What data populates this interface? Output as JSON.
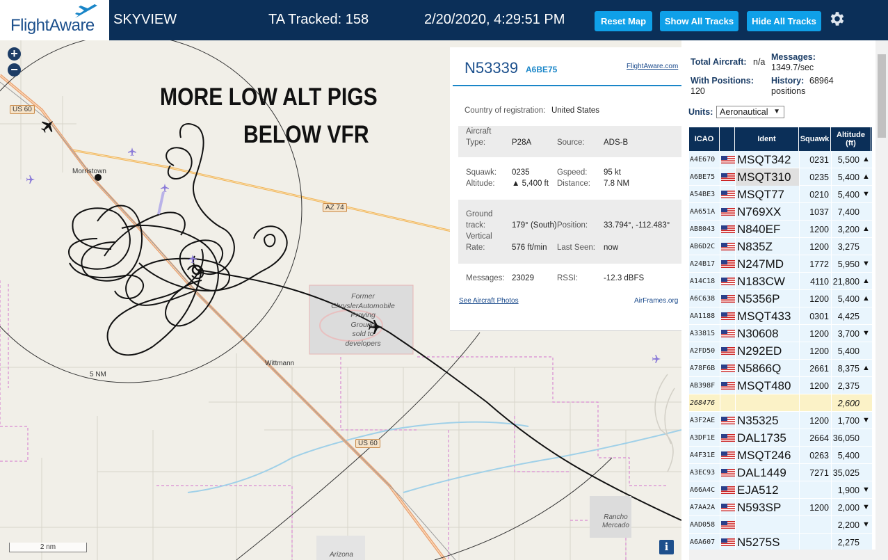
{
  "header": {
    "logo": "FlightAware",
    "app_title": "SKYVIEW",
    "tracked": "TA Tracked: 158",
    "datetime": "2/20/2020, 4:29:51 PM",
    "buttons": {
      "reset": "Reset Map",
      "show_all": "Show All Tracks",
      "hide_all": "Hide All Tracks"
    },
    "settings_icon": "gear-icon"
  },
  "map": {
    "zoom_in": "+",
    "zoom_out": "−",
    "annotation_line1": "MORE LOW ALT PIGS",
    "annotation_line2": "BELOW VFR",
    "labels": {
      "morristown": "Morristown",
      "wittmann": "Wittmann",
      "range_ring": "5 NM",
      "proving_ground": [
        "Former",
        "ChryslerAutomobile",
        "Proving",
        "Ground",
        "sold to",
        "developers"
      ],
      "rancho": [
        "Rancho",
        "Mercado"
      ],
      "arizona": "Arizona"
    },
    "road_shields": {
      "us60_north": "US 60",
      "az74": "AZ 74",
      "us60_south": "US 60"
    },
    "scale": "2 nm",
    "info": "i",
    "colors": {
      "track": "#111111",
      "az74": "#f0b45a",
      "us60": "#e8a070",
      "water": "#9fd0e8",
      "boundary": "#d98ad2",
      "aircraft": "#8a7ad8"
    }
  },
  "popup": {
    "registration": "N53339",
    "hex": "A6BE75",
    "fa_link": "FlightAware.com",
    "country_label": "Country of registration:",
    "country": "United States",
    "aircraft_type_label_1": "Aircraft",
    "aircraft_type_label_2": "Type:",
    "aircraft_type": "P28A",
    "source_label": "Source:",
    "source": "ADS-B",
    "squawk_label": "Squawk:",
    "squawk": "0235",
    "gspeed_label": "Gspeed:",
    "gspeed": "95 kt",
    "altitude_label": "Altitude:",
    "altitude": "▲ 5,400 ft",
    "distance_label": "Distance:",
    "distance": "7.8 NM",
    "ground_label_1": "Ground",
    "ground_label_2": "track:",
    "ground_track": "179° (South)",
    "position_label": "Position:",
    "position": "33.794°, -112.483°",
    "vrate_label_1": "Vertical",
    "vrate_label_2": "Rate:",
    "vrate": "576 ft/min",
    "lastseen_label": "Last Seen:",
    "lastseen": "now",
    "messages_label": "Messages:",
    "messages": "23029",
    "rssi_label": "RSSI:",
    "rssi": "-12.3 dBFS",
    "photos_link": "See Aircraft Photos",
    "airframes_link": "AirFrames.org"
  },
  "stats": {
    "total_label": "Total Aircraft:",
    "total": "n/a",
    "messages_label": "Messages:",
    "messages": "1349.7/sec",
    "positions_label": "With Positions:",
    "positions": "120",
    "history_label": "History:",
    "history_value": "68964",
    "history_unit": "positions",
    "units_label": "Units:",
    "units_value": "Aeronautical"
  },
  "table": {
    "headers": {
      "icao": "ICAO",
      "ident": "Ident",
      "squawk": "Squawk",
      "altitude_1": "Altitude",
      "altitude_2": "(ft)"
    },
    "rows": [
      {
        "icao": "A4E670",
        "ident": "MSQT342",
        "squawk": "0231",
        "alt": "5,500",
        "trend": "▲",
        "flag": true
      },
      {
        "icao": "A6BE75",
        "ident": "MSQT310",
        "squawk": "0235",
        "alt": "5,400",
        "trend": "▲",
        "flag": true,
        "selected": true
      },
      {
        "icao": "A54BE3",
        "ident": "MSQT77",
        "squawk": "0210",
        "alt": "5,400",
        "trend": "▼",
        "flag": true
      },
      {
        "icao": "AA651A",
        "ident": "N769XX",
        "squawk": "1037",
        "alt": "7,400",
        "trend": "",
        "flag": true
      },
      {
        "icao": "AB8043",
        "ident": "N840EF",
        "squawk": "1200",
        "alt": "3,200",
        "trend": "▲",
        "flag": true
      },
      {
        "icao": "AB6D2C",
        "ident": "N835Z",
        "squawk": "1200",
        "alt": "3,275",
        "trend": "",
        "flag": true
      },
      {
        "icao": "A24B17",
        "ident": "N247MD",
        "squawk": "1772",
        "alt": "5,950",
        "trend": "▼",
        "flag": true
      },
      {
        "icao": "A14C18",
        "ident": "N183CW",
        "squawk": "4110",
        "alt": "21,800",
        "trend": "▲",
        "flag": true
      },
      {
        "icao": "A6C638",
        "ident": "N5356P",
        "squawk": "1200",
        "alt": "5,400",
        "trend": "▲",
        "flag": true
      },
      {
        "icao": "AA1188",
        "ident": "MSQT433",
        "squawk": "0301",
        "alt": "4,425",
        "trend": "",
        "flag": true
      },
      {
        "icao": "A33815",
        "ident": "N30608",
        "squawk": "1200",
        "alt": "3,700",
        "trend": "▼",
        "flag": true
      },
      {
        "icao": "A2FD50",
        "ident": "N292ED",
        "squawk": "1200",
        "alt": "5,400",
        "trend": "",
        "flag": true
      },
      {
        "icao": "A78F6B",
        "ident": "N5866Q",
        "squawk": "2661",
        "alt": "8,375",
        "trend": "▲",
        "flag": true
      },
      {
        "icao": "AB398F",
        "ident": "MSQT480",
        "squawk": "1200",
        "alt": "2,375",
        "trend": "",
        "flag": true
      },
      {
        "icao": "268476",
        "ident": "",
        "squawk": "",
        "alt": "2,600",
        "trend": "",
        "flag": false,
        "nopos": true
      },
      {
        "icao": "A3F2AE",
        "ident": "N35325",
        "squawk": "1200",
        "alt": "1,700",
        "trend": "▼",
        "flag": true
      },
      {
        "icao": "A3DF1E",
        "ident": "DAL1735",
        "squawk": "2664",
        "alt": "36,050",
        "trend": "",
        "flag": true
      },
      {
        "icao": "A4F31E",
        "ident": "MSQT246",
        "squawk": "0263",
        "alt": "5,400",
        "trend": "",
        "flag": true
      },
      {
        "icao": "A3EC93",
        "ident": "DAL1449",
        "squawk": "7271",
        "alt": "35,025",
        "trend": "",
        "flag": true
      },
      {
        "icao": "A66A4C",
        "ident": "EJA512",
        "squawk": "",
        "alt": "1,900",
        "trend": "▼",
        "flag": true
      },
      {
        "icao": "A7AA2A",
        "ident": "N593SP",
        "squawk": "1200",
        "alt": "2,000",
        "trend": "▼",
        "flag": true
      },
      {
        "icao": "AAD058",
        "ident": "",
        "squawk": "",
        "alt": "2,200",
        "trend": "▼",
        "flag": true
      },
      {
        "icao": "A6A607",
        "ident": "N5275S",
        "squawk": "",
        "alt": "2,275",
        "trend": "",
        "flag": true
      }
    ]
  }
}
